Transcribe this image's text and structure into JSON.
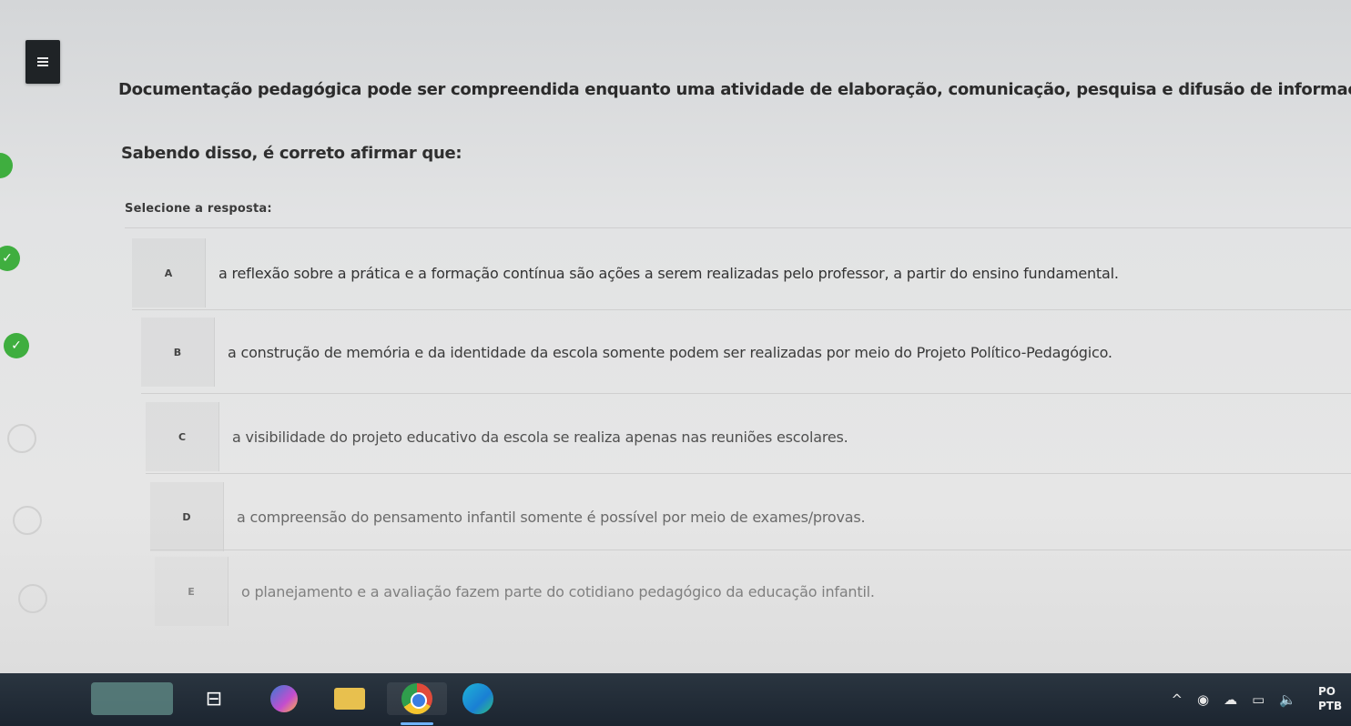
{
  "question": {
    "text": "Documentação pedagógica pode ser compreendida enquanto uma atividade de elaboração, comunicação, pesquisa e difusão de informações.",
    "subtext": "Sabendo disso, é correto afirmar que:",
    "select_label": "Selecione a resposta:"
  },
  "options": [
    {
      "letter": "A",
      "text": "a reflexão sobre a prática e a formação contínua são ações a serem realizadas pelo professor, a partir do ensino fundamental."
    },
    {
      "letter": "B",
      "text": "a construção de memória e da identidade da escola somente podem ser realizadas por meio do Projeto Político-Pedagógico."
    },
    {
      "letter": "C",
      "text": "a visibilidade do projeto educativo da escola se realiza apenas nas reuniões escolares."
    },
    {
      "letter": "D",
      "text": "a compreensão do pensamento infantil somente é possível por meio de exames/provas."
    },
    {
      "letter": "E",
      "text": "o planejamento e a avaliação fazem parte do cotidiano pedagógico da educação infantil."
    }
  ],
  "icons": {
    "menu": "hamburger-icon",
    "completed": "check-circle-icon",
    "pending": "empty-circle-icon"
  },
  "colors": {
    "completed_green": "#3fae3f",
    "taskbar": "#1c2530"
  },
  "taskbar": {
    "clock_line1": "PO",
    "clock_line2": "PTB"
  }
}
